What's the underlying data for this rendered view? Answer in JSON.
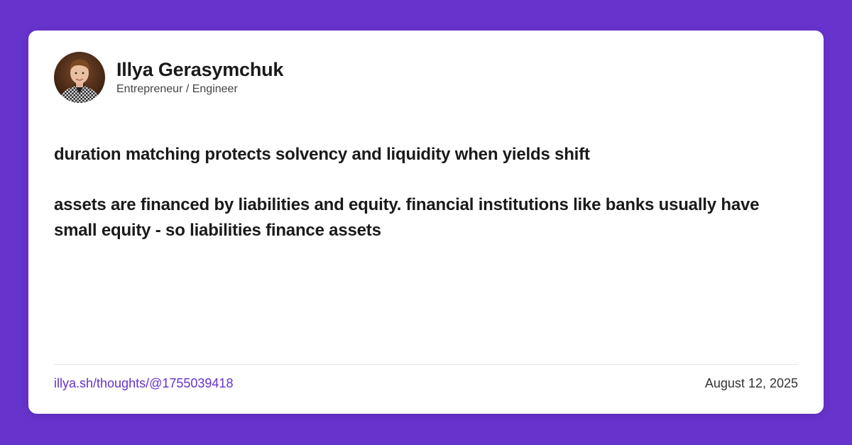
{
  "colors": {
    "background": "#6633cc",
    "card": "#ffffff",
    "link": "#6633cc",
    "text": "#1a1a1a"
  },
  "author": {
    "name": "Illya Gerasymchuk",
    "title": "Entrepreneur / Engineer",
    "avatar_icon": "avatar-photo"
  },
  "post": {
    "paragraphs": [
      "duration matching protects solvency and liquidity when yields shift",
      "assets are financed by liabilities and equity. financial institutions like banks usually have small equity - so liabilities finance assets"
    ]
  },
  "footer": {
    "link": "illya.sh/thoughts/@1755039418",
    "date": "August 12, 2025"
  }
}
